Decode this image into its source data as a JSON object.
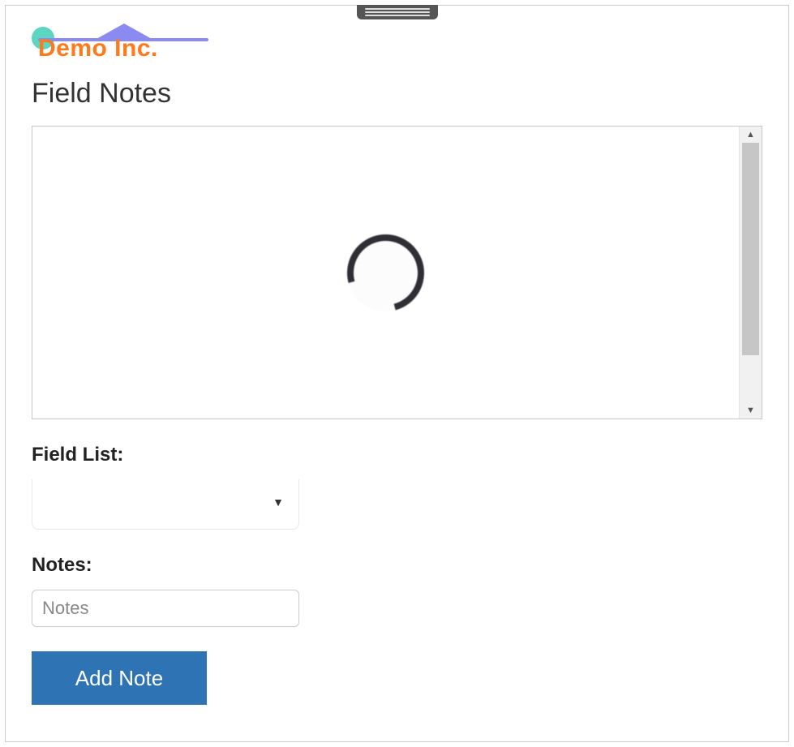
{
  "logo": {
    "text": "Demo Inc."
  },
  "page": {
    "title": "Field Notes"
  },
  "map": {
    "loading": true
  },
  "form": {
    "field_list": {
      "label": "Field List:",
      "selected": ""
    },
    "notes": {
      "label": "Notes:",
      "value": "",
      "placeholder": "Notes"
    },
    "add_button": {
      "label": "Add Note"
    }
  }
}
